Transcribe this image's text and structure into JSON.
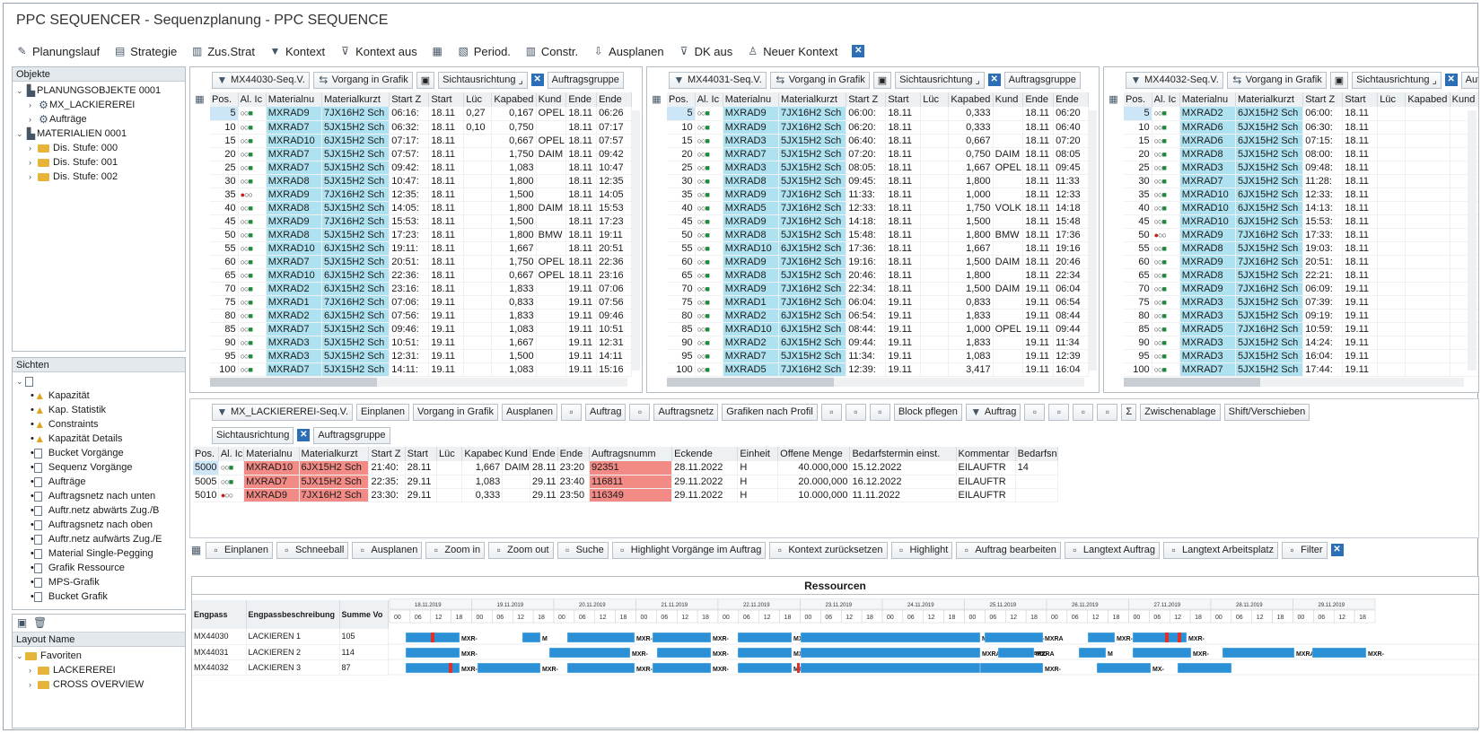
{
  "app": {
    "title": "PPC SEQUENCER - Sequenzplanung - PPC SEQUENCE"
  },
  "toolbar": [
    {
      "icon": "pencil-icon",
      "label": "Planungslauf"
    },
    {
      "icon": "strategy-icon",
      "label": "Strategie"
    },
    {
      "icon": "strategy-plus-icon",
      "label": "Zus.Strat"
    },
    {
      "icon": "filter-icon",
      "label": "Kontext"
    },
    {
      "icon": "filter-off-icon",
      "label": "Kontext aus"
    },
    {
      "icon": "calendar-icon",
      "label": ""
    },
    {
      "icon": "period-icon",
      "label": "Period."
    },
    {
      "icon": "constraint-icon",
      "label": "Constr."
    },
    {
      "icon": "unplan-icon",
      "label": "Ausplanen"
    },
    {
      "icon": "filter-off-icon",
      "label": "DK aus"
    },
    {
      "icon": "context-icon",
      "label": "Neuer Kontext"
    }
  ],
  "objects": {
    "header": "Objekte",
    "tree": [
      {
        "label": "PLANUNGSOBJEKTE 0001",
        "level": 0,
        "icon": "structure-icon"
      },
      {
        "label": "MX_LACKIEREREI",
        "level": 1,
        "icon": "object-icon"
      },
      {
        "label": "Aufträge",
        "level": 1,
        "icon": "order-icon"
      },
      {
        "label": "MATERIALIEN 0001",
        "level": 0,
        "icon": "structure-icon"
      },
      {
        "label": "Dis. Stufe: 000",
        "level": 1,
        "icon": "folder-icon"
      },
      {
        "label": "Dis. Stufe: 001",
        "level": 1,
        "icon": "folder-icon"
      },
      {
        "label": "Dis. Stufe: 002",
        "level": 1,
        "icon": "folder-icon"
      }
    ]
  },
  "views": {
    "header": "Sichten",
    "items": [
      "Kapazität",
      "Kap. Statistik",
      "Constraints",
      "Kapazität Details",
      "Bucket Vorgänge",
      "Sequenz Vorgänge",
      "Aufträge",
      "Auftragsnetz nach unten",
      "Auftr.netz abwärts Zug./B",
      "Auftragsnetz nach oben",
      "Auftr.netz aufwärts Zug./E",
      "Material Single-Pegging",
      "Grafik Ressource",
      "MPS-Grafik",
      "Bucket Grafik"
    ]
  },
  "layout": {
    "header": "Layout Name",
    "items": [
      "Favoriten",
      "LACKEREREI",
      "CROSS OVERVIEW"
    ]
  },
  "seq_toolbar_labels": {
    "vorgang": "Vorgang in Grafik",
    "sicht": "Sichtausrichtung",
    "gruppe": "Auftragsgruppe"
  },
  "seq_columns": [
    "Pos.",
    "Al. Ic",
    "Materialnu",
    "Materialkurzt",
    "Start Z",
    "Start",
    "Lüc",
    "Kapabed",
    "Kund",
    "Ende",
    "Ende"
  ],
  "seq_panels": [
    {
      "name": "MX44030-Seq.V.",
      "rows": [
        [
          "5",
          "ok",
          "MXRAD9",
          "7JX16H2 Sch",
          "06:16:",
          "18.11",
          "0,27",
          "0,167",
          "OPEL",
          "18.11",
          "06:26"
        ],
        [
          "10",
          "ok",
          "MXRAD7",
          "5JX15H2 Sch",
          "06:32:",
          "18.11",
          "0,10",
          "0,750",
          "",
          "18.11",
          "07:17"
        ],
        [
          "15",
          "ok",
          "MXRAD10",
          "6JX15H2 Sch",
          "07:17:",
          "18.11",
          "",
          "0,667",
          "OPEL",
          "18.11",
          "07:57"
        ],
        [
          "20",
          "ok",
          "MXRAD7",
          "5JX15H2 Sch",
          "07:57:",
          "18.11",
          "",
          "1,750",
          "DAIM",
          "18.11",
          "09:42"
        ],
        [
          "25",
          "ok",
          "MXRAD7",
          "5JX15H2 Sch",
          "09:42:",
          "18.11",
          "",
          "1,083",
          "",
          "18.11",
          "10:47"
        ],
        [
          "30",
          "ok",
          "MXRAD8",
          "5JX15H2 Sch",
          "10:47:",
          "18.11",
          "",
          "1,800",
          "",
          "18.11",
          "12:35"
        ],
        [
          "35",
          "warn",
          "MXRAD9",
          "7JX16H2 Sch",
          "12:35:",
          "18.11",
          "",
          "1,500",
          "",
          "18.11",
          "14:05"
        ],
        [
          "40",
          "ok",
          "MXRAD8",
          "5JX15H2 Sch",
          "14:05:",
          "18.11",
          "",
          "1,800",
          "DAIM",
          "18.11",
          "15:53"
        ],
        [
          "45",
          "ok",
          "MXRAD9",
          "7JX16H2 Sch",
          "15:53:",
          "18.11",
          "",
          "1,500",
          "",
          "18.11",
          "17:23"
        ],
        [
          "50",
          "ok",
          "MXRAD8",
          "5JX15H2 Sch",
          "17:23:",
          "18.11",
          "",
          "1,800",
          "BMW",
          "18.11",
          "19:11"
        ],
        [
          "55",
          "ok",
          "MXRAD10",
          "6JX15H2 Sch",
          "19:11:",
          "18.11",
          "",
          "1,667",
          "",
          "18.11",
          "20:51"
        ],
        [
          "60",
          "ok",
          "MXRAD7",
          "5JX15H2 Sch",
          "20:51:",
          "18.11",
          "",
          "1,750",
          "OPEL",
          "18.11",
          "22:36"
        ],
        [
          "65",
          "ok",
          "MXRAD10",
          "6JX15H2 Sch",
          "22:36:",
          "18.11",
          "",
          "0,667",
          "OPEL",
          "18.11",
          "23:16"
        ],
        [
          "70",
          "ok",
          "MXRAD2",
          "6JX15H2 Sch",
          "23:16:",
          "18.11",
          "",
          "1,833",
          "",
          "19.11",
          "07:06"
        ],
        [
          "75",
          "ok",
          "MXRAD1",
          "7JX16H2 Sch",
          "07:06:",
          "19.11",
          "",
          "0,833",
          "",
          "19.11",
          "07:56"
        ],
        [
          "80",
          "ok",
          "MXRAD2",
          "6JX15H2 Sch",
          "07:56:",
          "19.11",
          "",
          "1,833",
          "",
          "19.11",
          "09:46"
        ],
        [
          "85",
          "ok",
          "MXRAD7",
          "5JX15H2 Sch",
          "09:46:",
          "19.11",
          "",
          "1,083",
          "",
          "19.11",
          "10:51"
        ],
        [
          "90",
          "ok",
          "MXRAD3",
          "5JX15H2 Sch",
          "10:51:",
          "19.11",
          "",
          "1,667",
          "",
          "19.11",
          "12:31"
        ],
        [
          "95",
          "ok",
          "MXRAD3",
          "5JX15H2 Sch",
          "12:31:",
          "19.11",
          "",
          "1,500",
          "",
          "19.11",
          "14:11"
        ],
        [
          "100",
          "ok",
          "MXRAD7",
          "5JX15H2 Sch",
          "14:11:",
          "19.11",
          "",
          "1,083",
          "",
          "19.11",
          "15:16"
        ]
      ]
    },
    {
      "name": "MX44031-Seq.V.",
      "rows": [
        [
          "5",
          "ok",
          "MXRAD9",
          "7JX16H2 Sch",
          "06:00:",
          "18.11",
          "",
          "0,333",
          "",
          "18.11",
          "06:20"
        ],
        [
          "10",
          "ok",
          "MXRAD9",
          "7JX16H2 Sch",
          "06:20:",
          "18.11",
          "",
          "0,333",
          "",
          "18.11",
          "06:40"
        ],
        [
          "15",
          "ok",
          "MXRAD3",
          "5JX15H2 Sch",
          "06:40:",
          "18.11",
          "",
          "0,667",
          "",
          "18.11",
          "07:20"
        ],
        [
          "20",
          "ok",
          "MXRAD7",
          "5JX15H2 Sch",
          "07:20:",
          "18.11",
          "",
          "0,750",
          "DAIM",
          "18.11",
          "08:05"
        ],
        [
          "25",
          "ok",
          "MXRAD3",
          "5JX15H2 Sch",
          "08:05:",
          "18.11",
          "",
          "1,667",
          "OPEL",
          "18.11",
          "09:45"
        ],
        [
          "30",
          "ok",
          "MXRAD8",
          "5JX15H2 Sch",
          "09:45:",
          "18.11",
          "",
          "1,800",
          "",
          "18.11",
          "11:33"
        ],
        [
          "35",
          "ok",
          "MXRAD9",
          "7JX16H2 Sch",
          "11:33:",
          "18.11",
          "",
          "1,000",
          "",
          "18.11",
          "12:33"
        ],
        [
          "40",
          "ok",
          "MXRAD5",
          "7JX16H2 Sch",
          "12:33:",
          "18.11",
          "",
          "1,750",
          "VOLK",
          "18.11",
          "14:18"
        ],
        [
          "45",
          "ok",
          "MXRAD9",
          "7JX16H2 Sch",
          "14:18:",
          "18.11",
          "",
          "1,500",
          "",
          "18.11",
          "15:48"
        ],
        [
          "50",
          "ok",
          "MXRAD8",
          "5JX15H2 Sch",
          "15:48:",
          "18.11",
          "",
          "1,800",
          "BMW",
          "18.11",
          "17:36"
        ],
        [
          "55",
          "ok",
          "MXRAD10",
          "6JX15H2 Sch",
          "17:36:",
          "18.11",
          "",
          "1,667",
          "",
          "18.11",
          "19:16"
        ],
        [
          "60",
          "ok",
          "MXRAD9",
          "7JX16H2 Sch",
          "19:16:",
          "18.11",
          "",
          "1,500",
          "DAIM",
          "18.11",
          "20:46"
        ],
        [
          "65",
          "ok",
          "MXRAD8",
          "5JX15H2 Sch",
          "20:46:",
          "18.11",
          "",
          "1,800",
          "",
          "18.11",
          "22:34"
        ],
        [
          "70",
          "ok",
          "MXRAD9",
          "7JX16H2 Sch",
          "22:34:",
          "18.11",
          "",
          "1,500",
          "DAIM",
          "19.11",
          "06:04"
        ],
        [
          "75",
          "ok",
          "MXRAD1",
          "7JX16H2 Sch",
          "06:04:",
          "19.11",
          "",
          "0,833",
          "",
          "19.11",
          "06:54"
        ],
        [
          "80",
          "ok",
          "MXRAD2",
          "6JX15H2 Sch",
          "06:54:",
          "19.11",
          "",
          "1,833",
          "",
          "19.11",
          "08:44"
        ],
        [
          "85",
          "ok",
          "MXRAD10",
          "6JX15H2 Sch",
          "08:44:",
          "19.11",
          "",
          "1,000",
          "OPEL",
          "19.11",
          "09:44"
        ],
        [
          "90",
          "ok",
          "MXRAD2",
          "6JX15H2 Sch",
          "09:44:",
          "19.11",
          "",
          "1,833",
          "",
          "19.11",
          "11:34"
        ],
        [
          "95",
          "ok",
          "MXRAD7",
          "5JX15H2 Sch",
          "11:34:",
          "19.11",
          "",
          "1,083",
          "",
          "19.11",
          "12:39"
        ],
        [
          "100",
          "ok",
          "MXRAD5",
          "7JX16H2 Sch",
          "12:39:",
          "19.11",
          "",
          "3,417",
          "",
          "19.11",
          "16:04"
        ]
      ]
    },
    {
      "name": "MX44032-Seq.V.",
      "rows": [
        [
          "5",
          "ok",
          "MXRAD2",
          "6JX15H2 Sch",
          "06:00:",
          "18.11"
        ],
        [
          "10",
          "ok",
          "MXRAD6",
          "5JX15H2 Sch",
          "06:30:",
          "18.11"
        ],
        [
          "15",
          "ok",
          "MXRAD6",
          "6JX15H2 Sch",
          "07:15:",
          "18.11"
        ],
        [
          "20",
          "ok",
          "MXRAD8",
          "5JX15H2 Sch",
          "08:00:",
          "18.11"
        ],
        [
          "25",
          "ok",
          "MXRAD3",
          "5JX15H2 Sch",
          "09:48:",
          "18.11"
        ],
        [
          "30",
          "ok",
          "MXRAD7",
          "5JX15H2 Sch",
          "11:28:",
          "18.11"
        ],
        [
          "35",
          "ok",
          "MXRAD10",
          "6JX15H2 Sch",
          "12:33:",
          "18.11"
        ],
        [
          "40",
          "ok",
          "MXRAD10",
          "6JX15H2 Sch",
          "14:13:",
          "18.11"
        ],
        [
          "45",
          "ok",
          "MXRAD10",
          "6JX15H2 Sch",
          "15:53:",
          "18.11"
        ],
        [
          "50",
          "warn",
          "MXRAD9",
          "7JX16H2 Sch",
          "17:33:",
          "18.11"
        ],
        [
          "55",
          "ok",
          "MXRAD8",
          "5JX15H2 Sch",
          "19:03:",
          "18.11"
        ],
        [
          "60",
          "ok",
          "MXRAD9",
          "7JX16H2 Sch",
          "20:51:",
          "18.11"
        ],
        [
          "65",
          "ok",
          "MXRAD8",
          "5JX15H2 Sch",
          "22:21:",
          "18.11"
        ],
        [
          "70",
          "ok",
          "MXRAD9",
          "7JX16H2 Sch",
          "06:09:",
          "19.11"
        ],
        [
          "75",
          "ok",
          "MXRAD3",
          "5JX15H2 Sch",
          "07:39:",
          "19.11"
        ],
        [
          "80",
          "ok",
          "MXRAD3",
          "5JX15H2 Sch",
          "09:19:",
          "19.11"
        ],
        [
          "85",
          "ok",
          "MXRAD5",
          "7JX16H2 Sch",
          "10:59:",
          "19.11"
        ],
        [
          "90",
          "ok",
          "MXRAD3",
          "5JX15H2 Sch",
          "14:24:",
          "19.11"
        ],
        [
          "95",
          "ok",
          "MXRAD3",
          "5JX15H2 Sch",
          "16:04:",
          "19.11"
        ],
        [
          "100",
          "ok",
          "MXRAD7",
          "5JX15H2 Sch",
          "17:44:",
          "19.11"
        ]
      ]
    }
  ],
  "mid_toolbar": {
    "items": [
      "MX_LACKIEREREI-Seq.V.",
      "Einplanen",
      "Vorgang in Grafik",
      "Ausplanen",
      "",
      "Auftrag",
      "",
      "Auftragsnetz",
      "Grafiken nach Profil",
      "",
      "",
      "",
      "Block pflegen",
      "Auftrag",
      "",
      "",
      "",
      "",
      "Σ",
      "Zwischenablage",
      "Shift/Verschieben"
    ],
    "row2": [
      "Sichtausrichtung",
      "Auftragsgruppe"
    ]
  },
  "order_table": {
    "columns": [
      "Pos.",
      "Al. Ic",
      "Materialnu",
      "Materialkurzt",
      "Start Z",
      "Start",
      "Lüc",
      "Kapabed",
      "Kund",
      "Ende",
      "Ende",
      "Auftragsnumm",
      "Eckende",
      "Einheit",
      "Offene Menge",
      "Bedarfstermin einst.",
      "Kommentar",
      "Bedarfsn"
    ],
    "rows": [
      [
        "5000",
        "ok",
        "MXRAD10",
        "6JX15H2 Sch",
        "21:40:",
        "28.11",
        "",
        "1,667",
        "DAIM",
        "28.11",
        "23:20",
        "92351",
        "28.11.2022",
        "H",
        "40.000,000",
        "15.12.2022",
        "EILAUFTR",
        "14"
      ],
      [
        "5005",
        "ok",
        "MXRAD7",
        "5JX15H2 Sch",
        "22:35:",
        "29.11",
        "",
        "1,083",
        "",
        "29.11",
        "23:40",
        "116811",
        "29.11.2022",
        "H",
        "20.000,000",
        "16.12.2022",
        "EILAUFTR",
        ""
      ],
      [
        "5010",
        "warn",
        "MXRAD9",
        "7JX16H2 Sch",
        "23:30:",
        "29.11",
        "",
        "0,333",
        "",
        "29.11",
        "23:50",
        "116349",
        "29.11.2022",
        "H",
        "10.000,000",
        "11.11.2022",
        "EILAUFTR",
        ""
      ]
    ]
  },
  "graph_toolbar": [
    "Einplanen",
    "Schneeball",
    "Ausplanen",
    "Zoom in",
    "Zoom out",
    "Suche",
    "Highlight Vorgänge im Auftrag",
    "Kontext zurücksetzen",
    "Highlight",
    "Auftrag bearbeiten",
    "Langtext Auftrag",
    "Langtext Arbeitsplatz",
    "Filter"
  ],
  "resources": {
    "title": "Ressourcen",
    "columns": [
      "Engpass",
      "Engpassbeschreibung",
      "Summe Vo"
    ],
    "rows": [
      [
        "MX44030",
        "LACKIEREN 1",
        "105"
      ],
      [
        "MX44031",
        "LACKIEREN 2",
        "114"
      ],
      [
        "MX44032",
        "LACKIEREN 3",
        "87"
      ]
    ],
    "dates": [
      "18.11.2019",
      "19.11.2019",
      "20.11.2019",
      "21.11.2019",
      "22.11.2019",
      "23.11.2019",
      "24.11.2019",
      "25.11.2019",
      "26.11.2019",
      "27.11.2019",
      "28.11.2019",
      "29.11.2019"
    ],
    "hours": [
      "00",
      "06",
      "12",
      "18"
    ],
    "bar_labels": [
      [
        "MXR-",
        "M",
        "MXR-",
        "MXR-",
        "MXR-",
        "MXRAD9-SCHWARZ-",
        "MXRA",
        "MXR-",
        "MXR-"
      ],
      [
        "MXR-",
        "MXR-",
        "MXR-",
        "MXR-",
        "MXRAD10-SCHWARZ-",
        "MXRA",
        "M",
        "MXR-",
        "MXRA-",
        "MXR-"
      ],
      [
        "MXR-",
        "MXR-",
        "MXR-",
        "MXR-",
        "MXRAD2-GRÜN-",
        "MXRA",
        "MXR-",
        "MX-"
      ]
    ]
  },
  "colors": {
    "accent": "#2b90d6",
    "cyan": "#aee2f0",
    "pink": "#f28a86",
    "status_red": "#c81e1e",
    "status_green": "#1d8a3a"
  }
}
